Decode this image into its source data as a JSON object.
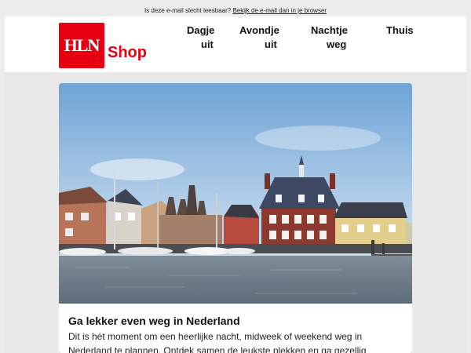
{
  "preheader": {
    "text": "Is deze e-mail slecht leesbaar?",
    "link": "Bekijk de e-mail dan in je browser"
  },
  "logo": {
    "mark": "HLN",
    "shop": "Shop",
    "brand_color": "#e60012"
  },
  "nav": [
    {
      "line1": "Dagje",
      "line2": "uit"
    },
    {
      "line1": "Avondje",
      "line2": "uit"
    },
    {
      "line1": "Nachtje",
      "line2": "weg"
    },
    {
      "line1": "Thuis",
      "line2": ""
    }
  ],
  "article": {
    "title": "Ga lekker even weg in Nederland",
    "body": "Dit is hét moment om een heerlijke nacht, midweek of weekend weg in Nederland te plannen. Ontdek samen de leukste plekken en ga gezellig"
  }
}
